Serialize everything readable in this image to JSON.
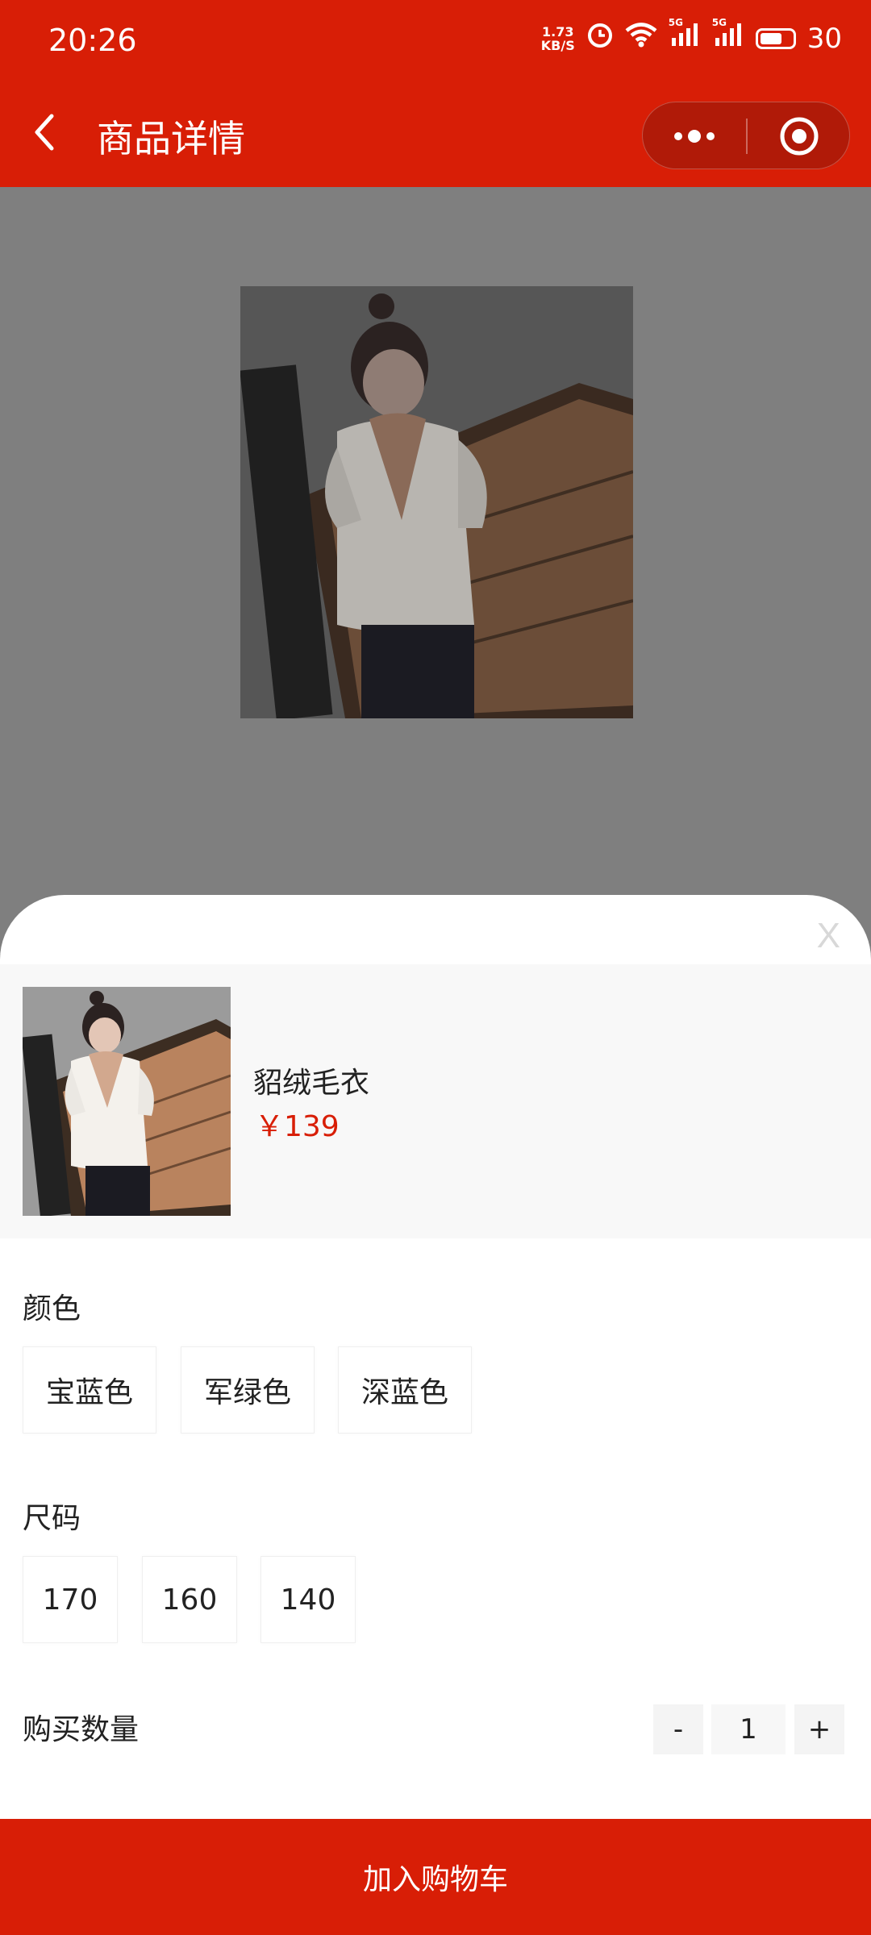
{
  "status_bar": {
    "time": "20:26",
    "net_speed_value": "1.73",
    "net_speed_unit": "KB/S",
    "signal_1_label": "5G",
    "signal_2_label": "5G",
    "battery_level": "30",
    "icons": [
      "alarm-icon",
      "wifi-icon",
      "signal-5g-icon",
      "signal-5g-icon",
      "battery-icon"
    ]
  },
  "header": {
    "title": "商品详情",
    "background_color": "#d81e06",
    "icons": [
      "back-arrow-icon",
      "more-dots-icon",
      "target-icon"
    ]
  },
  "sheet": {
    "close_label": "X",
    "product": {
      "name": "貂绒毛衣",
      "price": "￥139"
    },
    "color": {
      "label": "颜色",
      "options": [
        "宝蓝色",
        "军绿色",
        "深蓝色"
      ]
    },
    "size": {
      "label": "尺码",
      "options": [
        "170",
        "160",
        "140"
      ]
    },
    "quantity": {
      "label": "购买数量",
      "minus": "-",
      "value": "1",
      "plus": "+"
    },
    "add_to_cart": "加入购物车",
    "accent_color": "#d81e06"
  }
}
